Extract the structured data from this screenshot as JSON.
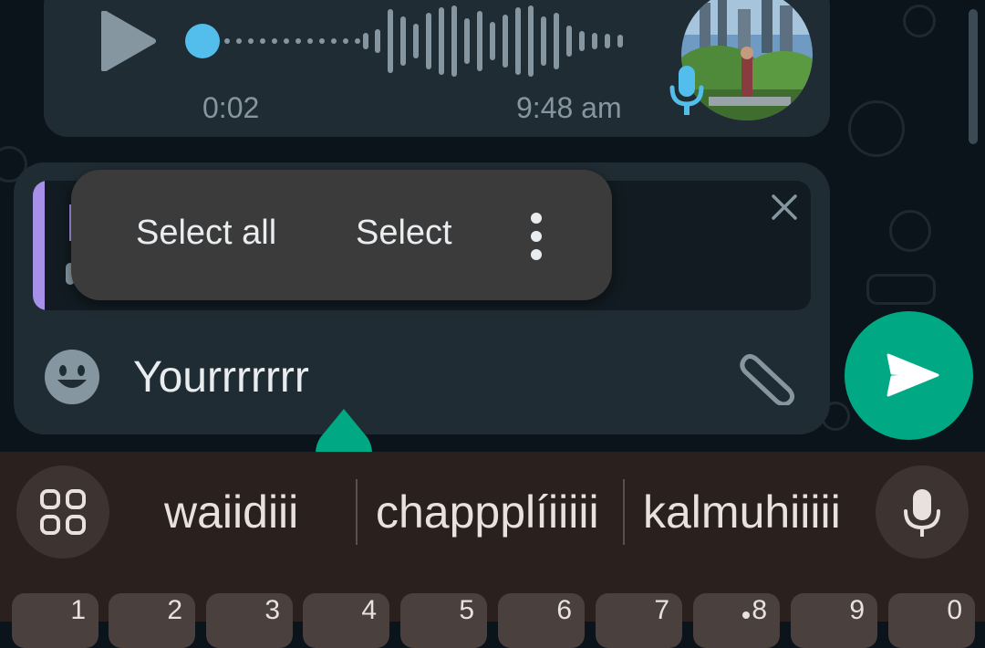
{
  "voice_message": {
    "duration": "0:02",
    "time": "9:48 am",
    "accent_color": "#53bdeb",
    "icons": [
      "play-icon",
      "microphone-icon"
    ]
  },
  "reply_preview": {
    "accent_color": "#a791e8",
    "close_icon": "close-icon"
  },
  "context_menu": {
    "items": [
      "Select all",
      "Select"
    ],
    "more_icon": "more-vertical-icon"
  },
  "composer": {
    "text": "Yourrrrrrr",
    "icons": [
      "emoji-icon",
      "paperclip-icon",
      "send-icon"
    ],
    "send_color": "#00a884"
  },
  "keyboard": {
    "suggestions": [
      "waiidiii",
      "chappplíiiiii",
      "kalmuhiiiii"
    ],
    "number_row": [
      "1",
      "2",
      "3",
      "4",
      "5",
      "6",
      "7",
      "8",
      "9",
      "0"
    ],
    "icons": [
      "grid-icon",
      "microphone-icon"
    ]
  }
}
